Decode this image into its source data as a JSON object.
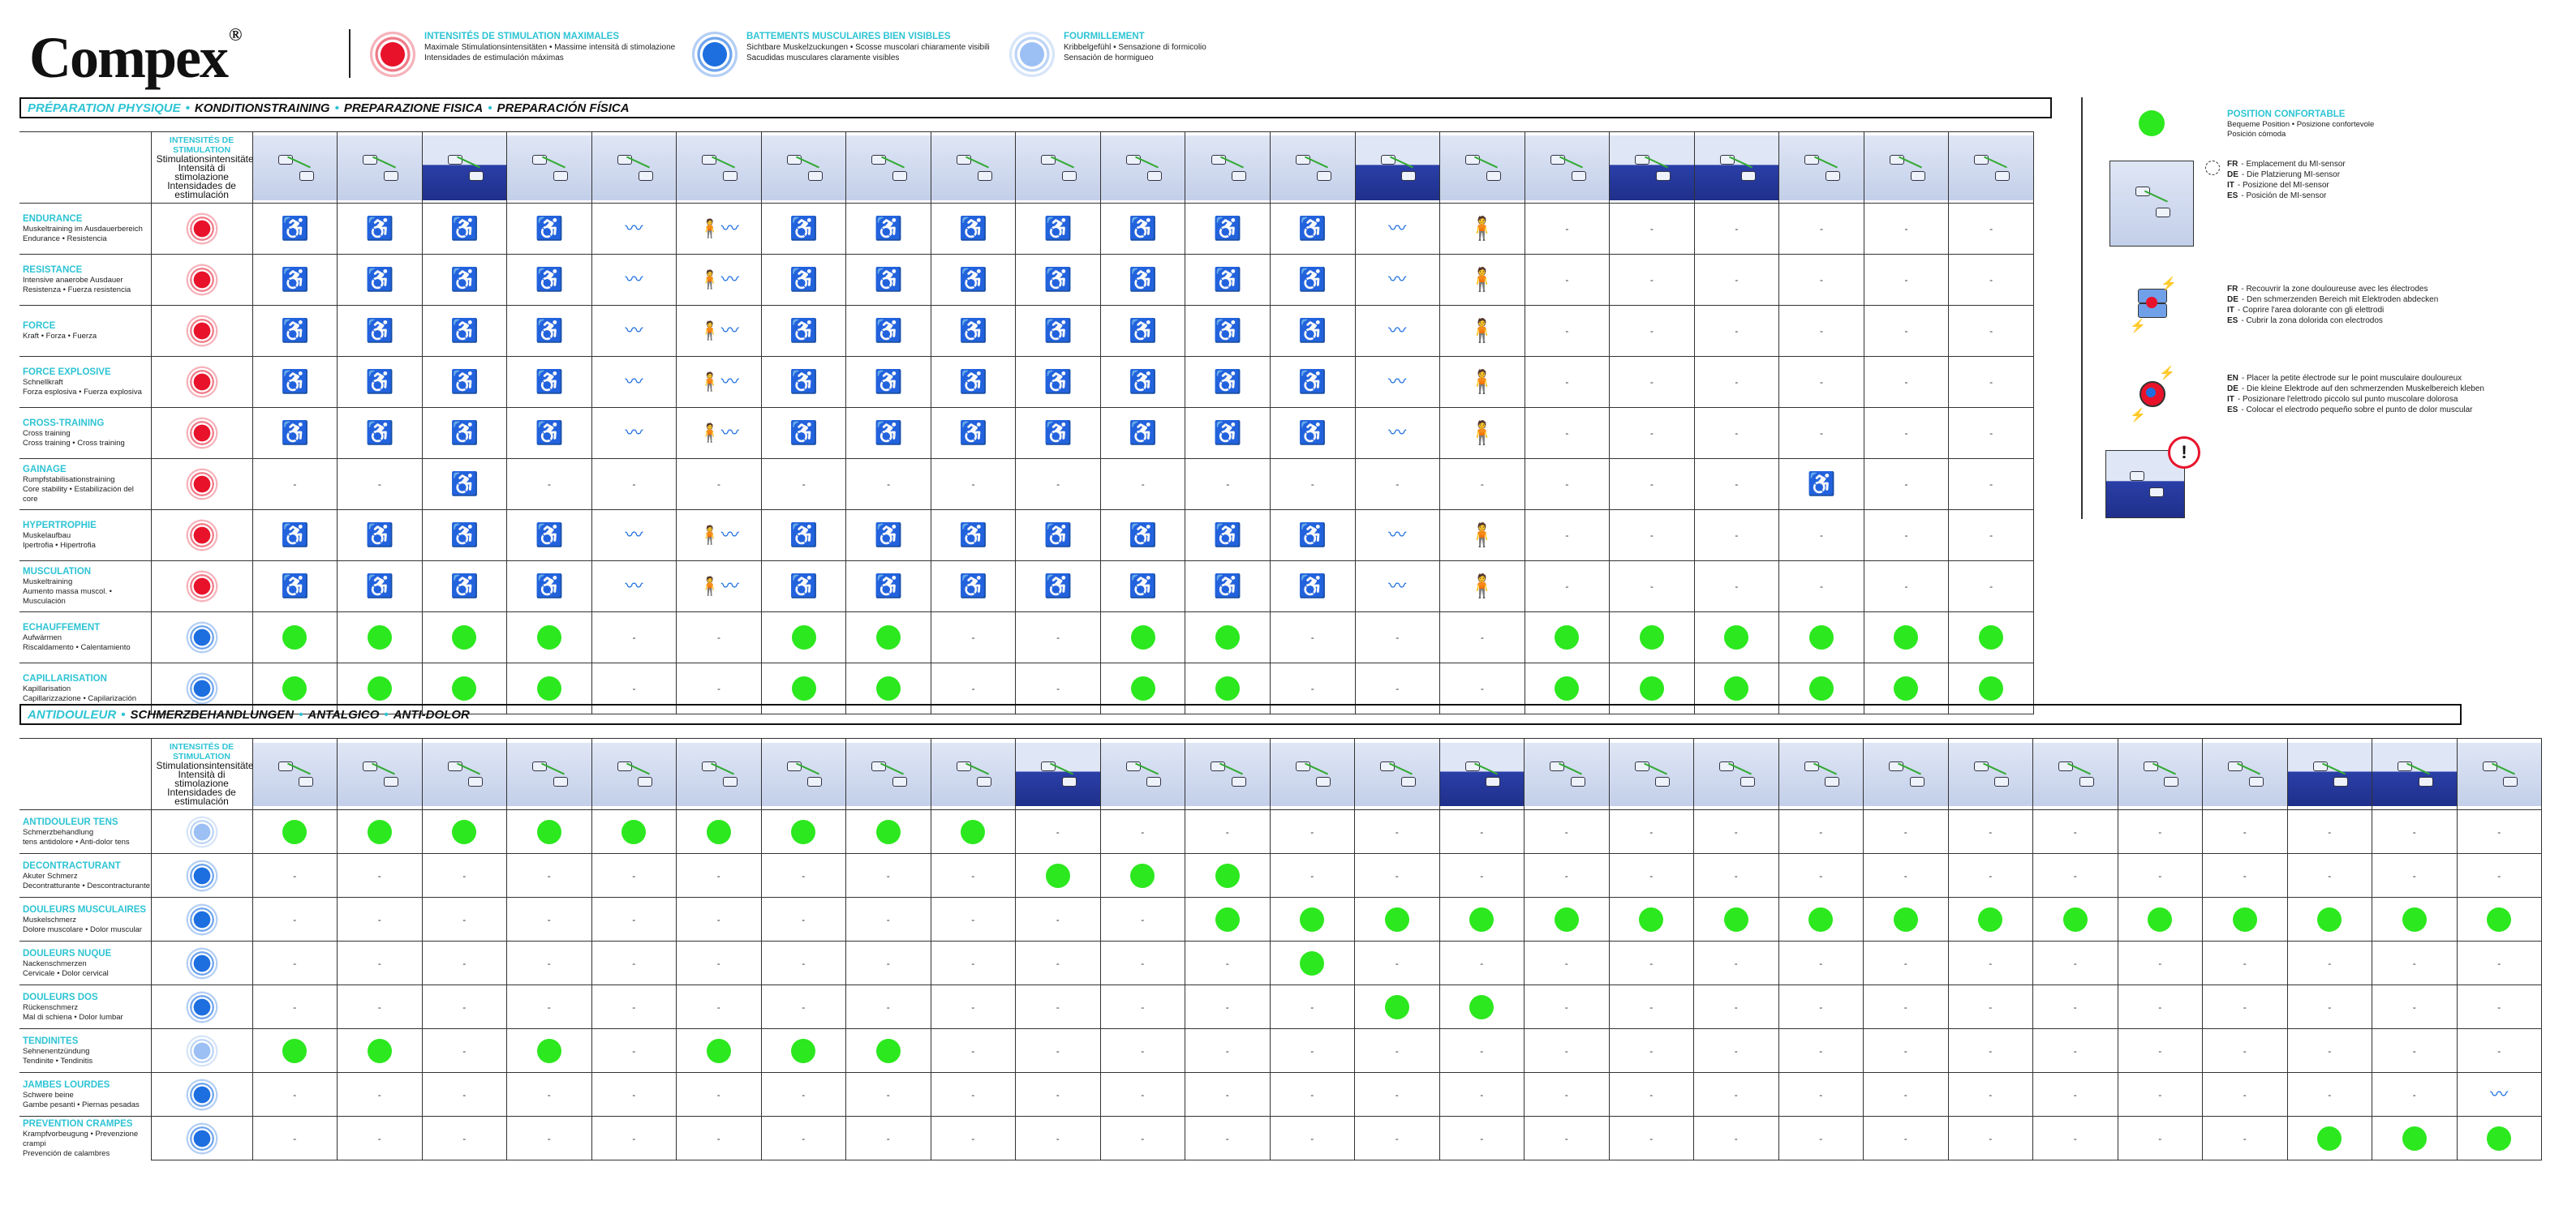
{
  "brand": {
    "name": "Compex",
    "reg": "®"
  },
  "legend": [
    {
      "kind": "red",
      "title": "INTENSITÉS DE STIMULATION MAXIMALES",
      "line1": "Maximale Stimulationsintensitäten • Massime intensità di stimolazione",
      "line2": "Intensidades de estimulación máximas"
    },
    {
      "kind": "blue",
      "title": "BATTEMENTS MUSCULAIRES BIEN VISIBLES",
      "line1": "Sichtbare Muskelzuckungen • Scosse muscolari chiaramente visibili",
      "line2": "Sacudidas musculares claramente visibles"
    },
    {
      "kind": "light",
      "title": "FOURMILLEMENT",
      "line1": "Kribbelgefühl • Sensazione di formicolio",
      "line2": "Sensación de hormigueo"
    }
  ],
  "sections": {
    "prep": {
      "t1": "PRÉPARATION PHYSIQUE",
      "t2": "KONDITIONSTRAINING",
      "t3": "PREPARAZIONE FISICA",
      "t4": "PREPARACIÓN FÍSICA"
    },
    "anti": {
      "t1": "ANTIDOULEUR",
      "t2": "SCHMERZBEHANDLUNGEN",
      "t3": "ANTALGICO",
      "t4": "ANTI-DOLOR"
    }
  },
  "intensity_header": {
    "title": "INTENSITÉS DE STIMULATION",
    "l1": "Stimulationsintensitäten",
    "l2": "Intensità di stimolazione",
    "l3": "Intensidades de estimulación"
  },
  "dash": "-",
  "prep_rows": [
    {
      "title": "ENDURANCE",
      "sub1": "Muskeltraining im Ausdauerbereich",
      "sub2": "Endurance • Resistencia",
      "intensity": "red",
      "cells": [
        "sit",
        "sit",
        "sit",
        "sit",
        "lie",
        "stand-lie",
        "chair",
        "sit",
        "sit",
        "sit",
        "sit",
        "sit",
        "sit",
        "lie",
        "stand",
        "-",
        "-",
        "-",
        "-",
        "-",
        "-"
      ]
    },
    {
      "title": "RESISTANCE",
      "sub1": "Intensive anaerobe Ausdauer",
      "sub2": "Resistenza • Fuerza resistencia",
      "intensity": "red",
      "cells": [
        "sit",
        "sit",
        "sit",
        "sit",
        "lie",
        "stand-lie",
        "chair",
        "sit",
        "sit",
        "sit",
        "sit",
        "sit",
        "sit",
        "lie",
        "stand",
        "-",
        "-",
        "-",
        "-",
        "-",
        "-"
      ]
    },
    {
      "title": "FORCE",
      "sub1": "Kraft • Forza • Fuerza",
      "sub2": "",
      "intensity": "red",
      "cells": [
        "sit",
        "sit",
        "sit",
        "sit",
        "lie",
        "stand-lie",
        "chair",
        "sit",
        "sit",
        "sit",
        "sit",
        "sit",
        "sit",
        "lie",
        "stand",
        "-",
        "-",
        "-",
        "-",
        "-",
        "-"
      ]
    },
    {
      "title": "FORCE EXPLOSIVE",
      "sub1": "Schnellkraft",
      "sub2": "Forza esplosiva • Fuerza explosiva",
      "intensity": "red",
      "cells": [
        "sit",
        "sit",
        "sit",
        "sit",
        "lie",
        "stand-lie",
        "chair",
        "sit",
        "sit",
        "sit",
        "sit",
        "sit",
        "sit",
        "lie",
        "stand",
        "-",
        "-",
        "-",
        "-",
        "-",
        "-"
      ]
    },
    {
      "title": "CROSS-TRAINING",
      "sub1": "Cross training",
      "sub2": "Cross training • Cross training",
      "intensity": "red",
      "cells": [
        "sit",
        "sit",
        "sit",
        "sit",
        "lie",
        "stand-lie",
        "chair",
        "sit",
        "sit",
        "sit",
        "sit",
        "sit",
        "sit",
        "lie",
        "stand",
        "-",
        "-",
        "-",
        "-",
        "-",
        "-"
      ]
    },
    {
      "title": "GAINAGE",
      "sub1": "Rumpfstabilisationstraining",
      "sub2": "Core stability • Estabilización del core",
      "intensity": "red",
      "cells": [
        "-",
        "-",
        "sit",
        "-",
        "-",
        "-",
        "-",
        "-",
        "-",
        "-",
        "-",
        "-",
        "-",
        "-",
        "-",
        "-",
        "-",
        "-",
        "sit",
        "-",
        "-"
      ]
    },
    {
      "title": "HYPERTROPHIE",
      "sub1": "Muskelaufbau",
      "sub2": "Ipertrofia • Hipertrofia",
      "intensity": "red",
      "cells": [
        "sit",
        "sit",
        "sit",
        "sit",
        "lie",
        "stand-lie",
        "chair",
        "sit",
        "sit",
        "sit",
        "sit",
        "sit",
        "sit",
        "lie",
        "stand",
        "-",
        "-",
        "-",
        "-",
        "-",
        "-"
      ]
    },
    {
      "title": "MUSCULATION",
      "sub1": "Muskeltraining",
      "sub2": "Aumento massa muscol. • Musculación",
      "intensity": "red",
      "cells": [
        "sit",
        "sit",
        "sit",
        "sit",
        "lie",
        "stand-lie",
        "chair",
        "sit",
        "sit",
        "sit",
        "sit",
        "sit",
        "sit",
        "lie",
        "stand",
        "-",
        "-",
        "-",
        "-",
        "-",
        "-"
      ]
    },
    {
      "title": "ECHAUFFEMENT",
      "sub1": "Aufwärmen",
      "sub2": "Riscaldamento • Calentamiento",
      "intensity": "blue",
      "cells": [
        "g",
        "g",
        "g",
        "g",
        "-",
        "-",
        "g",
        "g",
        "-",
        "-",
        "g",
        "g",
        "-",
        "-",
        "-",
        "g",
        "g",
        "g",
        "g",
        "g",
        "g"
      ]
    },
    {
      "title": "CAPILLARISATION",
      "sub1": "Kapillarisation",
      "sub2": "Capillarizzazione • Capilarización",
      "intensity": "blue",
      "cells": [
        "g",
        "g",
        "g",
        "g",
        "-",
        "-",
        "g",
        "g",
        "-",
        "-",
        "g",
        "g",
        "-",
        "-",
        "-",
        "g",
        "g",
        "g",
        "g",
        "g",
        "g"
      ]
    }
  ],
  "anti_rows": [
    {
      "title": "ANTIDOULEUR TENS",
      "sub1": "Schmerzbehandlung",
      "sub2": "tens antidolore • Anti-dolor tens",
      "intensity": "light",
      "cells": [
        "g",
        "g",
        "g",
        "g",
        "g",
        "g",
        "g",
        "g",
        "g",
        "-",
        "-",
        "-",
        "-",
        "-",
        "-",
        "-",
        "-",
        "-",
        "-",
        "-",
        "-",
        "-",
        "-",
        "-",
        "-",
        "-",
        "-"
      ]
    },
    {
      "title": "DECONTRACTURANT",
      "sub1": "Akuter Schmerz",
      "sub2": "Decontratturante • Descontracturante",
      "intensity": "blue",
      "cells": [
        "-",
        "-",
        "-",
        "-",
        "-",
        "-",
        "-",
        "-",
        "-",
        "g",
        "g",
        "g",
        "-",
        "-",
        "-",
        "-",
        "-",
        "-",
        "-",
        "-",
        "-",
        "-",
        "-",
        "-",
        "-",
        "-",
        "-"
      ]
    },
    {
      "title": "DOULEURS MUSCULAIRES",
      "sub1": "Muskelschmerz",
      "sub2": "Dolore muscolare • Dolor muscular",
      "intensity": "blue",
      "cells": [
        "-",
        "-",
        "-",
        "-",
        "-",
        "-",
        "-",
        "-",
        "-",
        "-",
        "-",
        "g",
        "g",
        "g",
        "g",
        "g",
        "g",
        "g",
        "g",
        "g",
        "g",
        "g",
        "g",
        "g",
        "g",
        "g",
        "g"
      ]
    },
    {
      "title": "DOULEURS NUQUE",
      "sub1": "Nackenschmerzen",
      "sub2": "Cervicale • Dolor cervical",
      "intensity": "blue",
      "cells": [
        "-",
        "-",
        "-",
        "-",
        "-",
        "-",
        "-",
        "-",
        "-",
        "-",
        "-",
        "-",
        "g",
        "-",
        "-",
        "-",
        "-",
        "-",
        "-",
        "-",
        "-",
        "-",
        "-",
        "-",
        "-",
        "-",
        "-"
      ]
    },
    {
      "title": "DOULEURS DOS",
      "sub1": "Rückenschmerz",
      "sub2": "Mal di schiena • Dolor lumbar",
      "intensity": "blue",
      "cells": [
        "-",
        "-",
        "-",
        "-",
        "-",
        "-",
        "-",
        "-",
        "-",
        "-",
        "-",
        "-",
        "-",
        "g",
        "g",
        "-",
        "-",
        "-",
        "-",
        "-",
        "-",
        "-",
        "-",
        "-",
        "-",
        "-",
        "-"
      ]
    },
    {
      "title": "TENDINITES",
      "sub1": "Sehnenentzündung",
      "sub2": "Tendinite • Tendinitis",
      "intensity": "light",
      "cells": [
        "g",
        "g",
        "-",
        "g",
        "-",
        "g",
        "g",
        "g",
        "-",
        "-",
        "-",
        "-",
        "-",
        "-",
        "-",
        "-",
        "-",
        "-",
        "-",
        "-",
        "-",
        "-",
        "-",
        "-",
        "-",
        "-",
        "-"
      ]
    },
    {
      "title": "JAMBES LOURDES",
      "sub1": "Schwere beine",
      "sub2": "Gambe pesanti • Piernas pesadas",
      "intensity": "blue",
      "cells": [
        "-",
        "-",
        "-",
        "-",
        "-",
        "-",
        "-",
        "-",
        "-",
        "-",
        "-",
        "-",
        "-",
        "-",
        "-",
        "-",
        "-",
        "-",
        "-",
        "-",
        "-",
        "-",
        "-",
        "-",
        "-",
        "-",
        "lie"
      ]
    },
    {
      "title": "PREVENTION CRAMPES",
      "sub1": "Krampfvorbeugung • Prevenzione crampi",
      "sub2": "Prevención de calambres",
      "intensity": "blue",
      "cells": [
        "-",
        "-",
        "-",
        "-",
        "-",
        "-",
        "-",
        "-",
        "-",
        "-",
        "-",
        "-",
        "-",
        "-",
        "-",
        "-",
        "-",
        "-",
        "-",
        "-",
        "-",
        "-",
        "-",
        "-",
        "g",
        "g",
        "g"
      ]
    }
  ],
  "right_legend": {
    "pos_title": "POSITION CONFORTABLE",
    "pos_l1": "Bequeme Position • Posizione confortevole",
    "pos_l2": "Posición cómoda",
    "mi": [
      {
        "lang": "FR",
        "text": "- Emplacement du MI-sensor"
      },
      {
        "lang": "DE",
        "text": "- Die Platzierung MI-sensor"
      },
      {
        "lang": "IT",
        "text": "- Posizione del MI-sensor"
      },
      {
        "lang": "ES",
        "text": "- Posición de MI-sensor"
      }
    ],
    "cover": [
      {
        "lang": "FR",
        "text": "- Recouvrir la zone douloureuse avec les électrodes"
      },
      {
        "lang": "DE",
        "text": "- Den schmerzenden Bereich mit Elektroden abdecken"
      },
      {
        "lang": "IT",
        "text": "- Coprire l'area dolorante con gli elettrodi"
      },
      {
        "lang": "ES",
        "text": "- Cubrir la zona dolorida con electrodos"
      }
    ],
    "small": [
      {
        "lang": "EN",
        "text": "- Placer la petite électrode sur le point musculaire douloureux"
      },
      {
        "lang": "DE",
        "text": "- Die kleine Elektrode auf den schmerzenden Muskelbereich kleben"
      },
      {
        "lang": "IT",
        "text": "- Posizionare l'elettrodo piccolo sul punto muscolare dolorosa"
      },
      {
        "lang": "ES",
        "text": "- Colocar el electrodo pequeño sobre el punto de dolor muscular"
      }
    ],
    "warn": "!"
  }
}
